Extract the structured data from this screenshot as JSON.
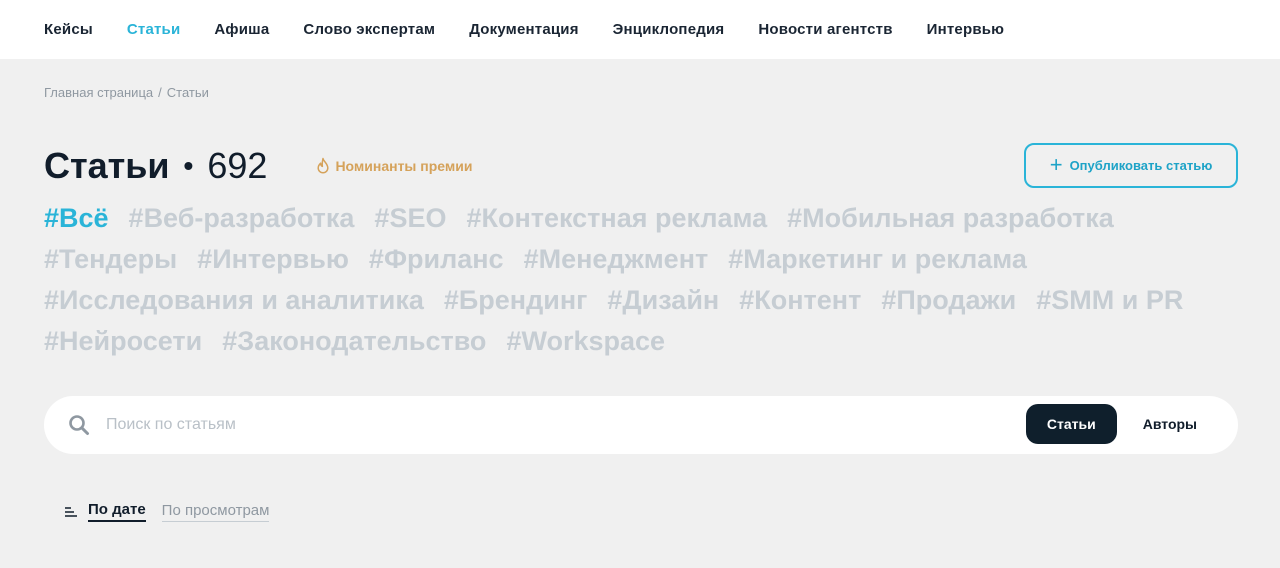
{
  "nav": {
    "items": [
      {
        "label": "Кейсы"
      },
      {
        "label": "Статьи"
      },
      {
        "label": "Афиша"
      },
      {
        "label": "Слово экспертам"
      },
      {
        "label": "Документация"
      },
      {
        "label": "Энциклопедия"
      },
      {
        "label": "Новости агентств"
      },
      {
        "label": "Интервью"
      }
    ],
    "active_index": 1,
    "accent_color": "#2ab4d8"
  },
  "breadcrumb": {
    "home": "Главная страница",
    "separator": "/",
    "current": "Статьи"
  },
  "header": {
    "title": "Статьи",
    "dot": "•",
    "count": "692",
    "nominees_label": "Номинанты премии",
    "nominees_icon": "flame-icon",
    "publish_icon": "plus-icon",
    "publish_label": "Опубликовать статью"
  },
  "tags": [
    "#Всё",
    "#Веб-разработка",
    "#SEO",
    "#Контекстная реклама",
    "#Мобильная разработка",
    "#Тендеры",
    "#Интервью",
    "#Фриланс",
    "#Менеджмент",
    "#Маркетинг и реклама",
    "#Исследования и аналитика",
    "#Брендинг",
    "#Дизайн",
    "#Контент",
    "#Продажи",
    "#SMM и PR",
    "#Нейросети",
    "#Законодательство",
    "#Workspace"
  ],
  "search": {
    "icon": "search-icon",
    "value": "",
    "placeholder": "Поиск по статьям",
    "mode_articles": "Статьи",
    "mode_authors": "Авторы"
  },
  "sort": {
    "icon": "sort-lines-icon",
    "by_date": "По дате",
    "by_views": "По просмотрам"
  }
}
